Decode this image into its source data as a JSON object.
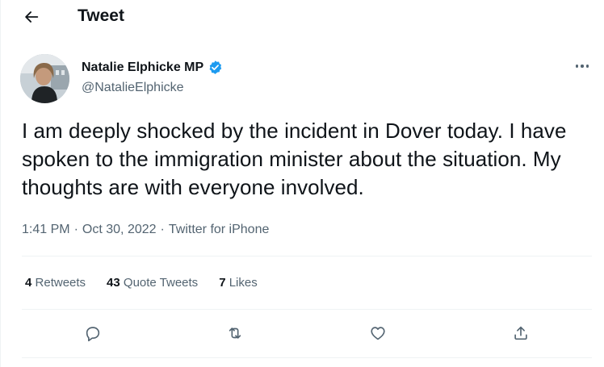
{
  "header": {
    "back_icon": "arrow-left-icon",
    "title": "Tweet"
  },
  "author": {
    "name": "Natalie Elphicke MP",
    "handle": "@NatalieElphicke",
    "verified": true,
    "verified_color": "#1d9bf0"
  },
  "tweet": {
    "text": "I am deeply shocked by the incident in Dover today. I have spoken to the immigration minister about the situation. My thoughts are with everyone involved.",
    "time": "1:41 PM",
    "separator": "·",
    "date": "Oct 30, 2022",
    "source": "Twitter for iPhone"
  },
  "stats": {
    "retweets_count": "4",
    "retweets_label": "Retweets",
    "quotes_count": "43",
    "quotes_label": "Quote Tweets",
    "likes_count": "7",
    "likes_label": "Likes"
  },
  "actions": [
    {
      "icon": "reply-icon"
    },
    {
      "icon": "retweet-icon"
    },
    {
      "icon": "like-heart-icon"
    },
    {
      "icon": "share-icon"
    }
  ],
  "colors": {
    "text_primary": "#0f1419",
    "text_secondary": "#536471",
    "divider": "#eff3f4",
    "accent": "#1d9bf0"
  }
}
